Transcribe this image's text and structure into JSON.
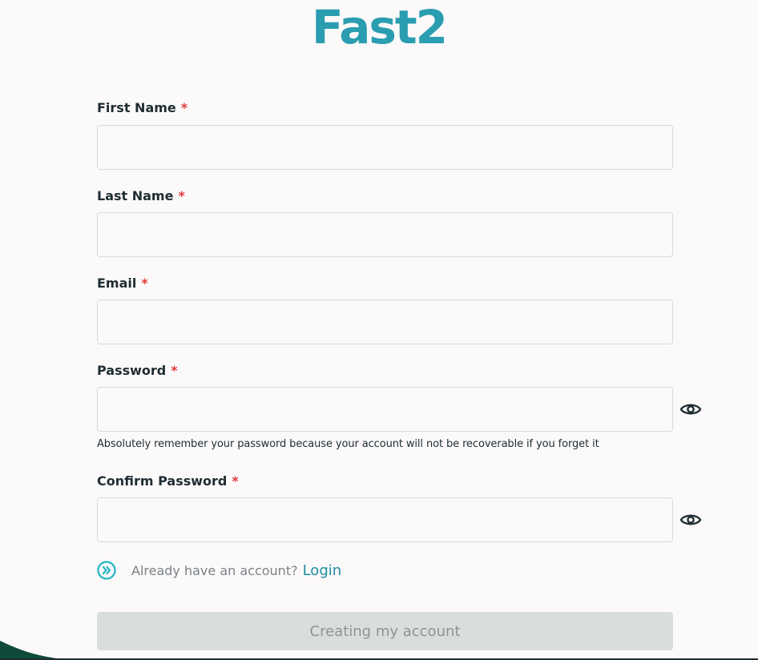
{
  "brand": {
    "logo_text": "Fast2"
  },
  "colors": {
    "brand": "#2a9db0",
    "required": "#e23b3b",
    "link": "#1e8fa2",
    "button_bg": "#d9dedd",
    "button_text": "#8b9396",
    "wave": "#0f4a3a"
  },
  "form": {
    "required_mark": "*",
    "first_name": {
      "label": "First Name",
      "value": "",
      "placeholder": ""
    },
    "last_name": {
      "label": "Last Name",
      "value": "",
      "placeholder": ""
    },
    "email": {
      "label": "Email",
      "value": "",
      "placeholder": ""
    },
    "password": {
      "label": "Password",
      "value": "",
      "placeholder": "",
      "hint": "Absolutely remember your password because your account will not be recoverable if you forget it"
    },
    "confirm_password": {
      "label": "Confirm Password",
      "value": "",
      "placeholder": ""
    },
    "login_prompt": "Already have an account?",
    "login_link": "Login",
    "submit_label": "Creating my account"
  },
  "icons": {
    "show_password": "eye-icon",
    "login_arrow": "double-chevron-right-circle-icon"
  }
}
